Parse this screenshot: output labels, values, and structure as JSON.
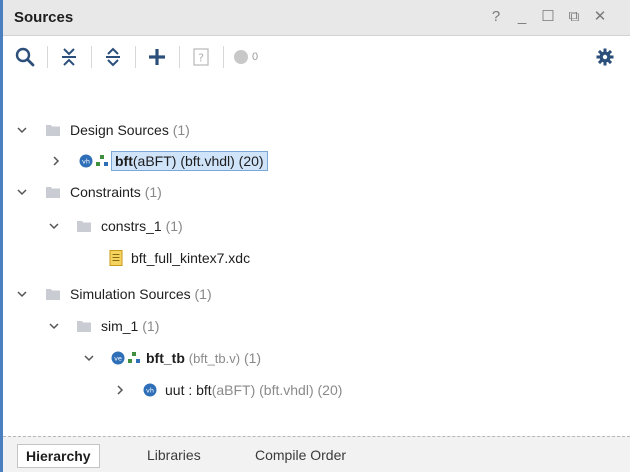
{
  "window": {
    "title": "Sources",
    "controls": [
      "?",
      "_",
      "☐",
      "⧉",
      "✕"
    ]
  },
  "toolbar": {
    "search_icon": "search-icon",
    "collapse_all_icon": "collapse-all-icon",
    "expand_all_icon": "expand-all-icon",
    "add_icon": "plus-icon",
    "properties_icon": "question-box-icon",
    "status_count": "0",
    "settings_icon": "gear-icon"
  },
  "tree": {
    "design_sources": {
      "label": "Design Sources",
      "count": "(1)"
    },
    "bft_top": {
      "name": "bft",
      "detail": "(aBFT) (bft.vhdl) (20)"
    },
    "constraints": {
      "label": "Constraints",
      "count": "(1)"
    },
    "constrs_1": {
      "label": "constrs_1",
      "count": "(1)"
    },
    "xdc_file": {
      "label": "bft_full_kintex7.xdc"
    },
    "simulation_sources": {
      "label": "Simulation Sources",
      "count": "(1)"
    },
    "sim_1": {
      "label": "sim_1",
      "count": "(1)"
    },
    "bft_tb": {
      "name": "bft_tb",
      "detail": "(bft_tb.v)",
      "count": "(1)"
    },
    "uut": {
      "name": "uut : bft",
      "detail": "(aBFT) (bft.vhdl) (20)"
    }
  },
  "bottom_tabs": {
    "hierarchy": "Hierarchy",
    "libraries": "Libraries",
    "compile_order": "Compile Order"
  },
  "colors": {
    "accent_border": "#4a7fc0",
    "selection_bg": "#cfe3f9",
    "folder": "#c9cdd3",
    "badge_blue": "#2f6fb8",
    "hier_green": "#3f8f3f"
  }
}
